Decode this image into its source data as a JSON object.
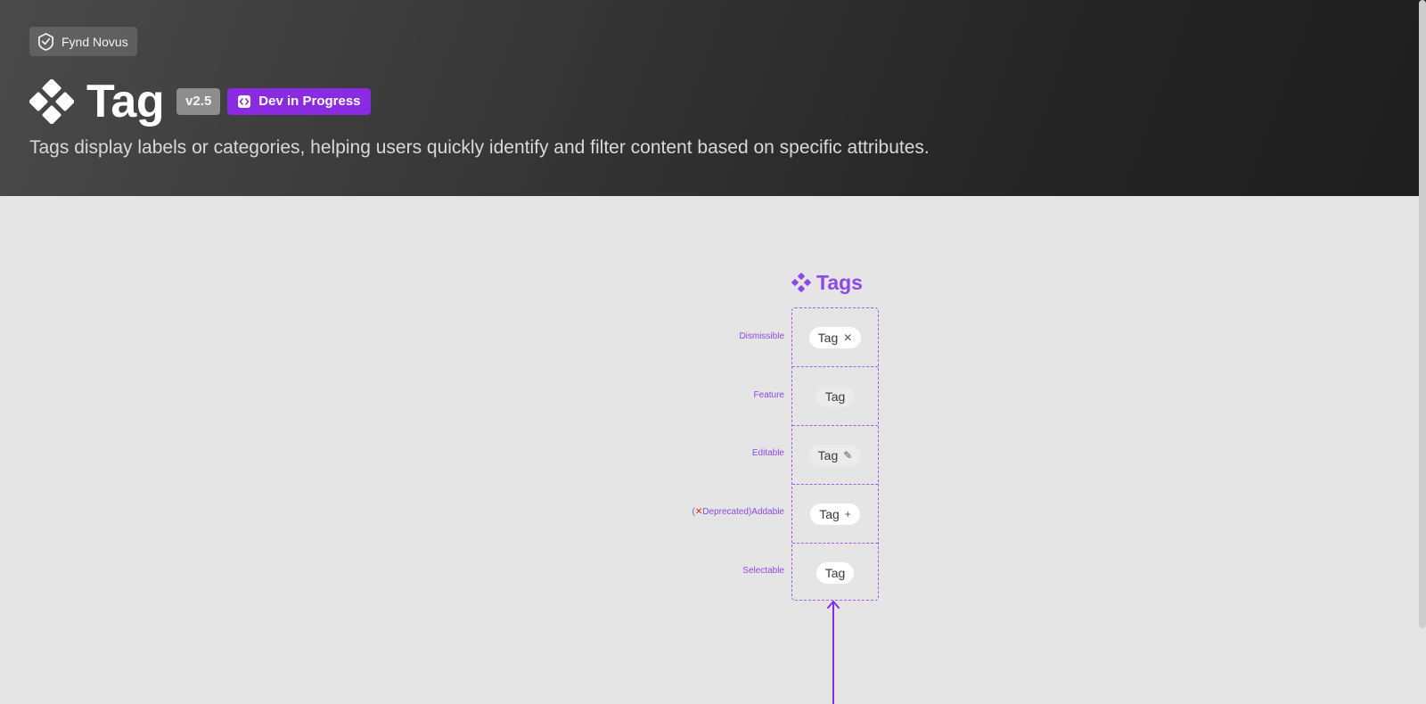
{
  "header": {
    "brand": "Fynd Novus",
    "title": "Tag",
    "version": "v2.5",
    "status": "Dev in Progress",
    "description": "Tags display labels or categories, helping users quickly identify and filter content based on specific attributes."
  },
  "component_set": {
    "title": "Tags",
    "rows": [
      {
        "label": "Dismissible",
        "tag_text": "Tag",
        "tag_icon": "close-icon",
        "tag_glyph": "✕",
        "tag_style": "white"
      },
      {
        "label": "Feature",
        "tag_text": "Tag",
        "tag_icon": "",
        "tag_glyph": "",
        "tag_style": "grey"
      },
      {
        "label": "Editable",
        "tag_text": "Tag",
        "tag_icon": "pencil-icon",
        "tag_glyph": "✎",
        "tag_style": "grey"
      },
      {
        "label_prefix": "(",
        "label_mark": "✕",
        "label": "Deprecated)Addable",
        "tag_text": "Tag",
        "tag_icon": "plus-icon",
        "tag_glyph": "+",
        "tag_style": "white"
      },
      {
        "label": "Selectable",
        "tag_text": "Tag",
        "tag_icon": "",
        "tag_glyph": "",
        "tag_style": "white"
      }
    ]
  },
  "colors": {
    "accent": "#8a2be2",
    "label_purple": "#8c49e6",
    "deprecated_red": "#e01e1e",
    "hero_dark": "#262626",
    "canvas": "#e5e5e5"
  }
}
